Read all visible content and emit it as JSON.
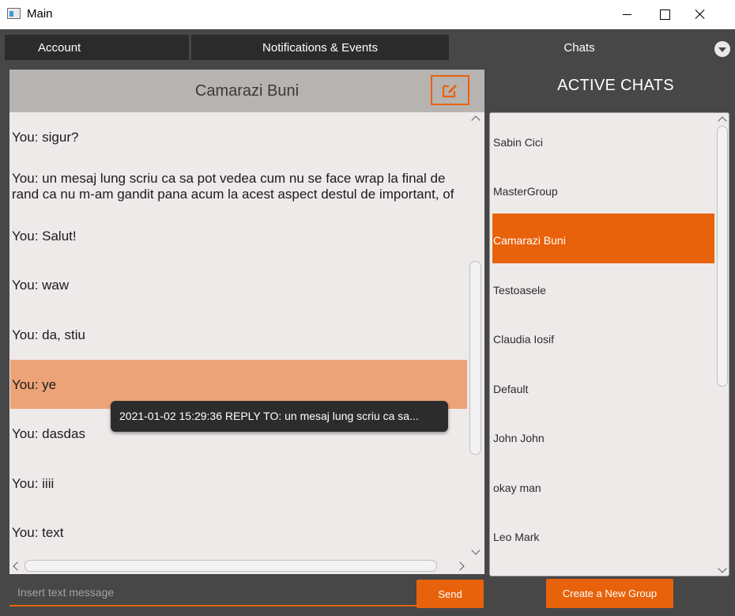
{
  "window": {
    "title": "Main"
  },
  "tabs": [
    {
      "label": "Account"
    },
    {
      "label": "Notifications & Events"
    },
    {
      "label": "Chats"
    }
  ],
  "chat": {
    "title": "Camarazi Buni",
    "messages": [
      {
        "text": "You: sigur?"
      },
      {
        "text": "You: un mesaj lung scriu ca sa pot vedea cum nu se face wrap la final de\nrand ca nu m-am gandit pana acum la acest aspect destul de important, of"
      },
      {
        "text": "You: Salut!"
      },
      {
        "text": "You: waw"
      },
      {
        "text": "You: da, stiu"
      },
      {
        "text": "You: ye"
      },
      {
        "text": "You: dasdas"
      },
      {
        "text": "You: iiii"
      },
      {
        "text": "You: text"
      }
    ],
    "tooltip": "2021-01-02 15:29:36 REPLY TO: un mesaj lung scriu ca sa...",
    "input_placeholder": "Insert text message",
    "send_label": "Send"
  },
  "sidebar": {
    "title": "ACTIVE CHATS",
    "items": [
      {
        "label": "Sabin Cici"
      },
      {
        "label": "MasterGroup"
      },
      {
        "label": "Camarazi Buni"
      },
      {
        "label": "Testoasele"
      },
      {
        "label": "Claudia Iosif"
      },
      {
        "label": "Default"
      },
      {
        "label": "John John"
      },
      {
        "label": "okay man"
      },
      {
        "label": "Leo Mark"
      }
    ],
    "create_label": "Create a New Group"
  },
  "colors": {
    "accent": "#e8620b",
    "selected_message": "#eca377",
    "background": "#474747"
  },
  "icons": [
    "app-icon",
    "minimize-icon",
    "maximize-icon",
    "close-icon",
    "dropdown-icon",
    "edit-icon"
  ]
}
